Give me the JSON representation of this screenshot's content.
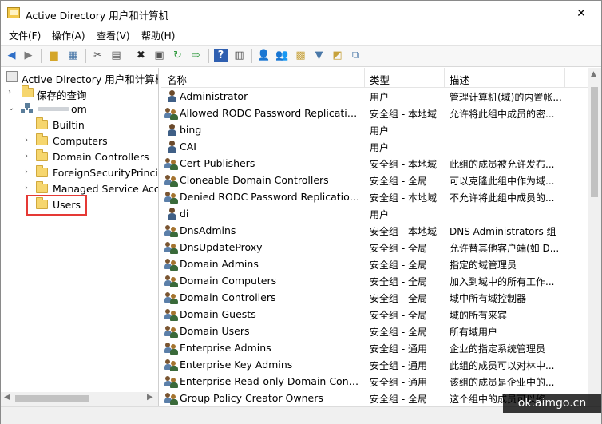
{
  "window": {
    "title": "Active Directory 用户和计算机"
  },
  "menu": [
    "文件(F)",
    "操作(A)",
    "查看(V)",
    "帮助(H)"
  ],
  "tree": {
    "root_label": "Active Directory 用户和计算机",
    "saved_queries": "保存的查询",
    "domain_suffix": "om",
    "children": [
      "Builtin",
      "Computers",
      "Domain Controllers",
      "ForeignSecurityPrincipa",
      "Managed Service Acco",
      "Users"
    ],
    "selected": "Users"
  },
  "columns": [
    "名称",
    "类型",
    "描述"
  ],
  "rows": [
    {
      "icon": "user-icon",
      "name": "Administrator",
      "type": "用户",
      "desc": "管理计算机(域)的内置帐..."
    },
    {
      "icon": "group-icon",
      "name": "Allowed RODC Password Replication ...",
      "type": "安全组 - 本地域",
      "desc": "允许将此组中成员的密..."
    },
    {
      "icon": "user-icon",
      "name": "bing",
      "type": "用户",
      "desc": ""
    },
    {
      "icon": "user-icon",
      "name": "CAI",
      "type": "用户",
      "desc": ""
    },
    {
      "icon": "group-icon",
      "name": "Cert Publishers",
      "type": "安全组 - 本地域",
      "desc": "此组的成员被允许发布..."
    },
    {
      "icon": "group-icon",
      "name": "Cloneable Domain Controllers",
      "type": "安全组 - 全局",
      "desc": "可以克隆此组中作为域..."
    },
    {
      "icon": "group-icon",
      "name": "Denied RODC Password Replication G...",
      "type": "安全组 - 本地域",
      "desc": "不允许将此组中成员的..."
    },
    {
      "icon": "user-icon",
      "name": "di",
      "type": "用户",
      "desc": ""
    },
    {
      "icon": "group-icon",
      "name": "DnsAdmins",
      "type": "安全组 - 本地域",
      "desc": "DNS Administrators 组"
    },
    {
      "icon": "group-icon",
      "name": "DnsUpdateProxy",
      "type": "安全组 - 全局",
      "desc": "允许替其他客户端(如 D..."
    },
    {
      "icon": "group-icon",
      "name": "Domain Admins",
      "type": "安全组 - 全局",
      "desc": "指定的域管理员"
    },
    {
      "icon": "group-icon",
      "name": "Domain Computers",
      "type": "安全组 - 全局",
      "desc": "加入到域中的所有工作..."
    },
    {
      "icon": "group-icon",
      "name": "Domain Controllers",
      "type": "安全组 - 全局",
      "desc": "域中所有域控制器"
    },
    {
      "icon": "group-icon",
      "name": "Domain Guests",
      "type": "安全组 - 全局",
      "desc": "域的所有来宾"
    },
    {
      "icon": "group-icon",
      "name": "Domain Users",
      "type": "安全组 - 全局",
      "desc": "所有域用户"
    },
    {
      "icon": "group-icon",
      "name": "Enterprise Admins",
      "type": "安全组 - 通用",
      "desc": "企业的指定系统管理员"
    },
    {
      "icon": "group-icon",
      "name": "Enterprise Key Admins",
      "type": "安全组 - 通用",
      "desc": "此组的成员可以对林中..."
    },
    {
      "icon": "group-icon",
      "name": "Enterprise Read-only Domain Controll...",
      "type": "安全组 - 通用",
      "desc": "该组的成员是企业中的..."
    },
    {
      "icon": "group-icon",
      "name": "Group Policy Creator Owners",
      "type": "安全组 - 全局",
      "desc": "这个组中的成员可以修..."
    }
  ],
  "watermark": "ok.aimgo.cn",
  "colors": {
    "highlight_box": "#e53935",
    "folder": "#f6d66e"
  }
}
